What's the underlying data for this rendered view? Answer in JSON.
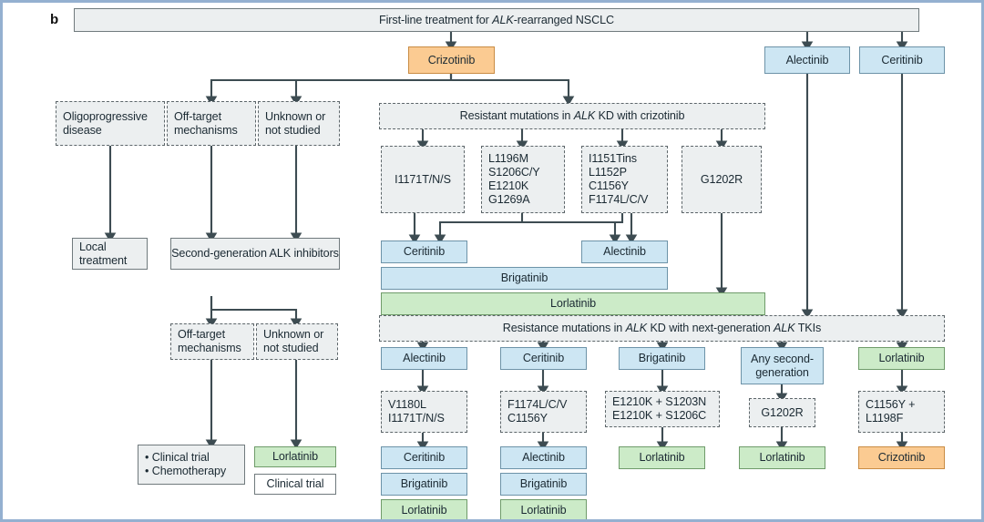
{
  "panel": {
    "letter": "b"
  },
  "header": {
    "title": "First-line treatment for ALK-rearranged NSCLC"
  },
  "first_line": {
    "crizotinib": "Crizotinib",
    "alectinib": "Alectinib",
    "ceritinib": "Ceritinib"
  },
  "crizotinib_branches": {
    "oligoprogressive": "Oligoprogressive disease",
    "off_target": "Off-target mechanisms",
    "unknown": "Unknown or not studied",
    "resistant_header": "Resistant mutations in ALK KD with crizotinib"
  },
  "crizotinib_outcomes": {
    "local_treatment": "Local treatment",
    "second_generation": "Second-generation ALK inhibitors"
  },
  "crizotinib_mutations": [
    {
      "id": "mut-i1171",
      "lines": [
        "I1171T/N/S"
      ]
    },
    {
      "id": "mut-l1196",
      "lines": [
        "L1196M",
        "S1206C/Y",
        "E1210K",
        "G1269A"
      ]
    },
    {
      "id": "mut-i1151",
      "lines": [
        "I1151Tins",
        "L1152P",
        "C1156Y",
        "F1174L/C/V"
      ]
    },
    {
      "id": "mut-g1202r",
      "lines": [
        "G1202R"
      ]
    }
  ],
  "crizotinib_next_drugs": {
    "ceritinib": "Ceritinib",
    "alectinib": "Alectinib",
    "brigatinib": "Brigatinib",
    "lorlatinib": "Lorlatinib"
  },
  "second_line_branches": {
    "off_target": "Off-target mechanisms",
    "unknown": "Unknown or not studied",
    "clinical_trial_chemo": [
      "• Clinical trial",
      "• Chemotherapy"
    ],
    "lorlatinib": "Lorlatinib",
    "clinical_trial": "Clinical trial"
  },
  "next_gen": {
    "header": "Resistance mutations in ALK KD with next-generation ALK TKIs",
    "columns": [
      {
        "id": "col-alectinib",
        "drug": "Alectinib",
        "drug_color": "blue",
        "mutations": [
          "V1180L",
          "I1171T/N/S"
        ],
        "treatments": [
          {
            "label": "Ceritinib",
            "color": "blue"
          },
          {
            "label": "Brigatinib",
            "color": "blue"
          },
          {
            "label": "Lorlatinib",
            "color": "green"
          }
        ]
      },
      {
        "id": "col-ceritinib",
        "drug": "Ceritinib",
        "drug_color": "blue",
        "mutations": [
          "F1174L/C/V",
          "C1156Y"
        ],
        "treatments": [
          {
            "label": "Alectinib",
            "color": "blue"
          },
          {
            "label": "Brigatinib",
            "color": "blue"
          },
          {
            "label": "Lorlatinib",
            "color": "green"
          }
        ]
      },
      {
        "id": "col-brigatinib",
        "drug": "Brigatinib",
        "drug_color": "blue",
        "mutations": [
          "E1210K + S1203N",
          "E1210K + S1206C"
        ],
        "treatments": [
          {
            "label": "Lorlatinib",
            "color": "green"
          }
        ]
      },
      {
        "id": "col-any-second-generation",
        "drug": "Any second-generation",
        "drug_color": "blue",
        "mutations": [
          "G1202R"
        ],
        "treatments": [
          {
            "label": "Lorlatinib",
            "color": "green"
          }
        ]
      },
      {
        "id": "col-lorlatinib",
        "drug": "Lorlatinib",
        "drug_color": "green",
        "mutations": [
          "C1156Y +",
          "L1198F"
        ],
        "treatments": [
          {
            "label": "Crizotinib",
            "color": "orange"
          }
        ]
      }
    ]
  },
  "colors": {
    "blue_fill": "#cde6f3",
    "green_fill": "#ccebc8",
    "orange_fill": "#fbcb92",
    "grey_fill": "#eceff0",
    "line": "#3d4c52",
    "frame": "#94b0d0"
  }
}
